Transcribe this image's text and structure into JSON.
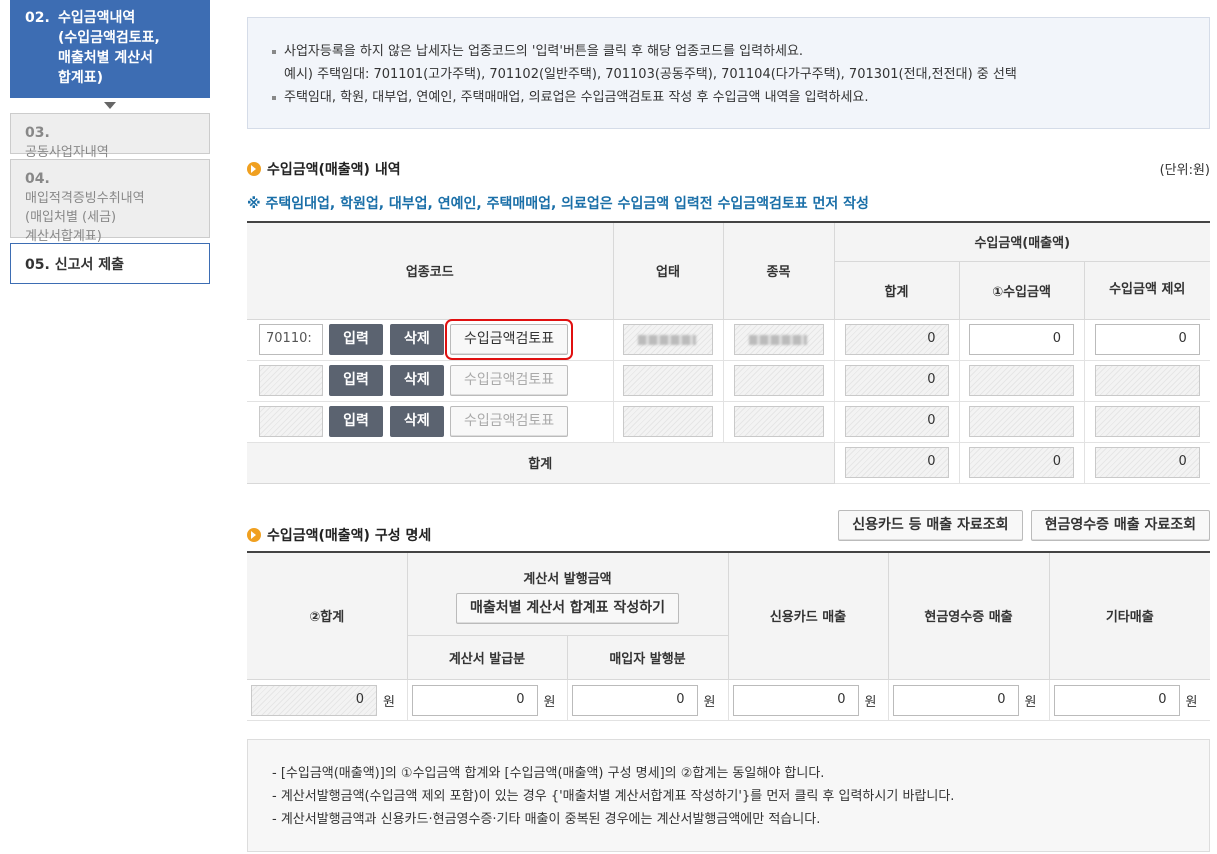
{
  "sidebar": {
    "active": {
      "num": "02.",
      "text": "수입금액내역\n(수입금액검토표,\n매출처별 계산서\n합계표)"
    },
    "step3": {
      "num": "03.",
      "text": "공동사업자내역"
    },
    "step4": {
      "num": "04.",
      "text": "매입적격증빙수취내역\n(매입처별 (세금)\n계산서합계표)"
    },
    "step5": {
      "num": "05.",
      "text": "신고서 제출"
    }
  },
  "notice": {
    "line1": "사업자등록을 하지 않은 납세자는 업종코드의 '입력'버튼을 클릭 후 해당 업종코드를 입력하세요.",
    "line2": "예시) 주택임대: 701101(고가주택), 701102(일반주택), 701103(공동주택), 701104(다가구주택), 701301(전대,전전대) 중 선택",
    "line3": "주택임대, 학원, 대부업, 연예인, 주택매매업, 의료업은 수입금액검토표 작성 후 수입금액 내역을 입력하세요."
  },
  "section1": {
    "title": "수입금액(매출액) 내역",
    "unit": "(단위:원)",
    "warning": "※ 주택임대업, 학원업, 대부업, 연예인, 주택매매업, 의료업은 수입금액 입력전 수입금액검토표 먼저 작성",
    "headers": {
      "code": "업종코드",
      "business": "업태",
      "item": "종목",
      "income_group": "수입금액(매출액)",
      "total": "합계",
      "income": "①수입금액",
      "exclude": "수입금액 제외"
    },
    "rows": [
      {
        "code": "70110:",
        "input": "입력",
        "delete": "삭제",
        "review": "수입금액검토표",
        "total": "0",
        "income": "0",
        "exclude": "0"
      },
      {
        "code": "",
        "input": "입력",
        "delete": "삭제",
        "review": "수입금액검토표",
        "total": "0",
        "income": "",
        "exclude": ""
      },
      {
        "code": "",
        "input": "입력",
        "delete": "삭제",
        "review": "수입금액검토표",
        "total": "0",
        "income": "",
        "exclude": ""
      }
    ],
    "sum_row": {
      "label": "합계",
      "total": "0",
      "income": "0",
      "exclude": "0"
    }
  },
  "section2": {
    "title": "수입금액(매출액) 구성 명세",
    "btn_card": "신용카드 등 매출 자료조회",
    "btn_cash": "현금영수증 매출 자료조회",
    "headers": {
      "total": "②합계",
      "invoice_group": "계산서 발행금액",
      "invoice_btn": "매출처별 계산서 합계표 작성하기",
      "issued": "계산서 발급분",
      "buyer_issued": "매입자 발행분",
      "card": "신용카드 매출",
      "cash": "현금영수증 매출",
      "etc": "기타매출"
    },
    "values": {
      "total": "0",
      "issued": "0",
      "buyer_issued": "0",
      "card": "0",
      "cash": "0",
      "etc": "0"
    },
    "won": "원"
  },
  "notes": {
    "line1": "- [수입금액(매출액)]의 ①수입금액 합계와 [수입금액(매출액) 구성 명세]의 ②합계는 동일해야 합니다.",
    "line2": "- 계산서발행금액(수입금액 제외 포함)이 있는 경우 {'매출처별 계산서합계표 작성하기'}를 먼저 클릭 후 입력하시기 바랍니다.",
    "line3": "- 계산서발행금액과 신용카드·현금영수증·기타 매출이 중복된 경우에는 계산서발행금액에만 적습니다."
  }
}
